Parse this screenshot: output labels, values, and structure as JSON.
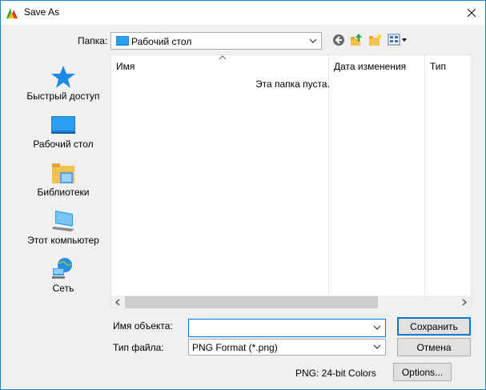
{
  "window": {
    "title": "Save As",
    "close_glyph": "✕"
  },
  "folder": {
    "label": "Папка:",
    "current": "Рабочий стол"
  },
  "toolbar": {
    "icons": [
      "back-icon",
      "up-folder-icon",
      "new-folder-icon",
      "view-menu-icon"
    ]
  },
  "places": [
    {
      "label": "Быстрый доступ",
      "icon": "quick-access-star-icon"
    },
    {
      "label": "Рабочий стол",
      "icon": "desktop-icon"
    },
    {
      "label": "Библиотеки",
      "icon": "libraries-icon"
    },
    {
      "label": "Этот компьютер",
      "icon": "computer-icon"
    },
    {
      "label": "Сеть",
      "icon": "network-icon"
    }
  ],
  "filelist": {
    "columns": [
      "Имя",
      "Дата изменения",
      "Тип"
    ],
    "empty_message": "Эта папка пуста."
  },
  "form": {
    "name_label": "Имя объекта:",
    "name_value": "",
    "type_label": "Тип файла:",
    "type_value": "PNG Format (*.png)"
  },
  "buttons": {
    "save": "Сохранить",
    "cancel": "Отмена",
    "options": "Options..."
  },
  "status_text": "PNG: 24-bit Colors",
  "colors": {
    "accent": "#0078d7",
    "star": "#1e8ae6"
  }
}
